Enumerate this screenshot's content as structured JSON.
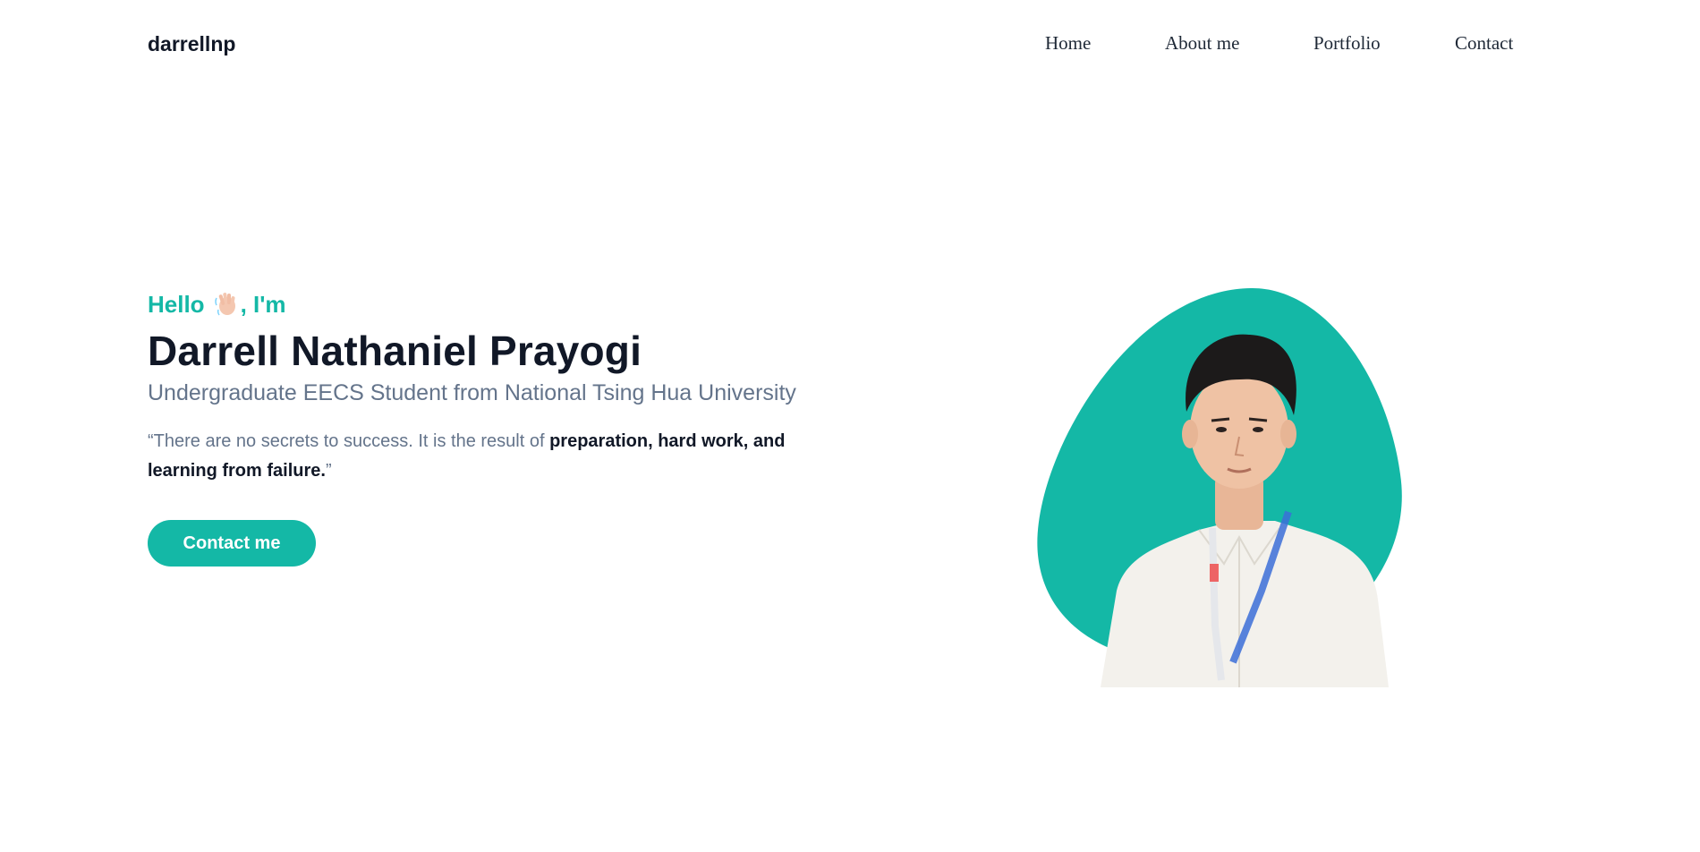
{
  "nav": {
    "brand": "darrellnp",
    "links": [
      "Home",
      "About me",
      "Portfolio",
      "Contact"
    ]
  },
  "hero": {
    "greeting_prefix": "Hello",
    "greeting_suffix": ", I'm",
    "wave_icon": "waving-hand-icon",
    "name": "Darrell Nathaniel Prayogi",
    "subtitle": "Undergraduate EECS Student from National Tsing Hua University",
    "quote_open": "“There are no secrets to success. It is the result of ",
    "quote_bold": "preparation, hard work, and learning from failure.",
    "quote_close": "”",
    "cta_label": "Contact me"
  },
  "colors": {
    "accent": "#14b8a6",
    "heading": "#111827",
    "muted": "#64748b"
  }
}
